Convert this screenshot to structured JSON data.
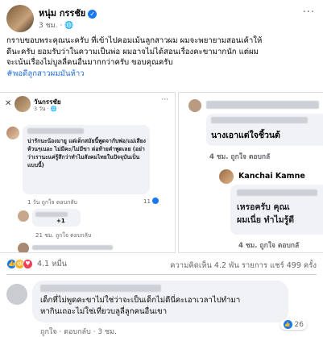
{
  "post": {
    "author": "หนุ่ม กรรชัย",
    "time": "3 ชม. ·",
    "more_icon": "more-dots-icon",
    "text_line1": "กราบขอบพระคุณนะครับ ที่เข้าไปคอมเม้นลูกสาวผม ผมจะพยายามสอนเค้าให้",
    "text_line2": "ดีนะครับ ยอมรับว่าในความเป็นพ่อ ผมอาจไม่ได้สอนเรื่องคะขามากนัก แต่ผม",
    "text_line3": "จะเน้นเรื่องไม่บูลลี่คนอื่นมากกว่าครับ ขอบคุณครับ",
    "hashtag": "#พอดีลูกสาวผมมันห้าว"
  },
  "screenshot_left": {
    "close_icon": "✕",
    "name": "วันกรรชัย",
    "time": "3 วัน · 🌐",
    "dots": "···",
    "comment_text": "น่ารักนะน้องมายู แต่เด็กสมัยนี้พูดจากับพ่อ/แม่เสียงห้วนๆเนอะ ไม่มีคะ/ไม่มีขา ต่อท้ายคำพูดเลย (อย่าว่าเรานะแค่รู้สึกว่าทำไมสังคมไทยในปัจจุบันเป็นแบบนี้)",
    "actions1": "1 วัน   ถูกใจ   ตอบกลับ",
    "count1": "11",
    "reply_text": "+1",
    "actions2": "21 ชม.   ถูกใจ   ตอบกลับ"
  },
  "screenshot_right": {
    "text1": "นางเอาแต่ใจชิ้วนต้",
    "actions1": "4 ชม.   ถูกใจ   ตอบกลั",
    "name2": "Kanchai Kamne",
    "text2_line1": "เหรอครับ คุณเ",
    "text2_line2": "ผมเนี่ย ทำไมรู้ดี",
    "actions2": "4 ชม.   ถูกใจ   ตอบกลั"
  },
  "stats": {
    "reaction_count": "4.1 หมื่น",
    "comments_shares": "ความคิดเห็น 4.2 พัน รายการ  แชร์ 499 ครั้ง"
  },
  "comment": {
    "text_line1": "เด็กที่ไม่พูดคะขาไม่ใช่ว่าจะเป็นเด็กไม่ดีนี่คะเอาเวลาไปทำมา",
    "text_line2": "หากินเถอะไม่ใช่เที่ยวบลูลี่ลูกคนอื่นเขา",
    "reaction_count": "26",
    "actions": "ถูกใจ · ตอบกลับ · 3 ชม."
  }
}
